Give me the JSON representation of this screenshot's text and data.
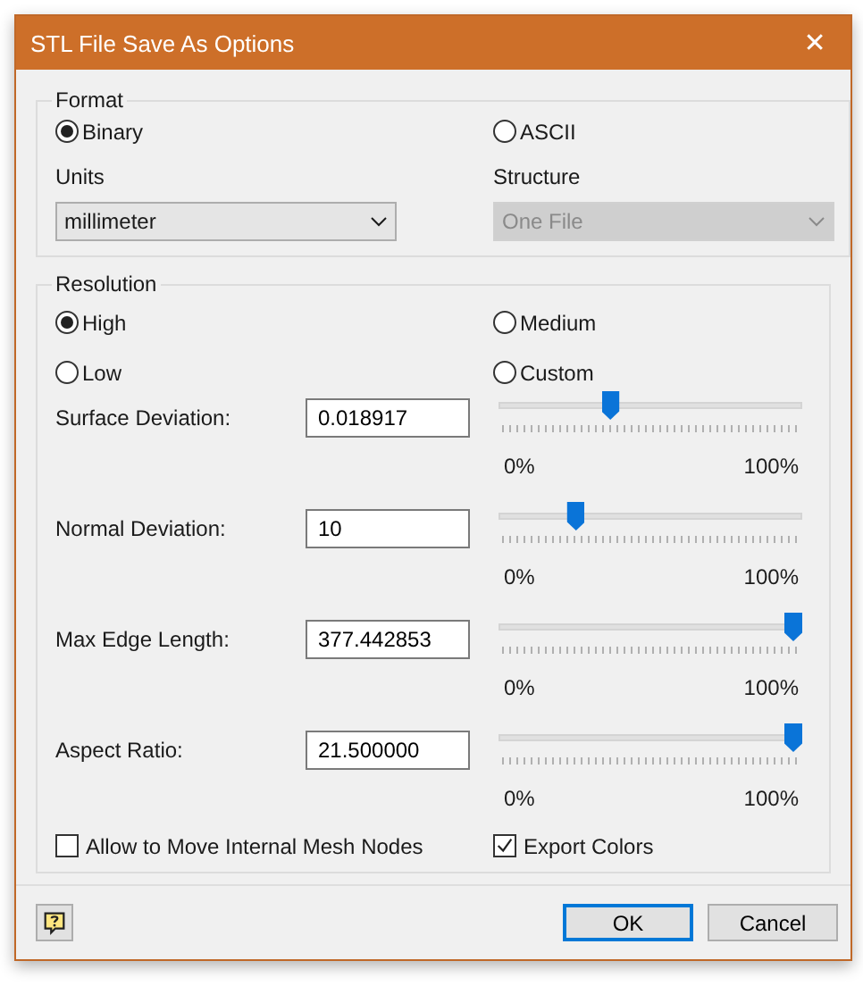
{
  "window": {
    "title": "STL File Save As Options",
    "close": "✕"
  },
  "format": {
    "title": "Format",
    "options": [
      {
        "label": "Binary",
        "selected": true
      },
      {
        "label": "ASCII",
        "selected": false
      }
    ],
    "units": {
      "label": "Units",
      "value": "millimeter",
      "disabled": false
    },
    "structure": {
      "label": "Structure",
      "value": "One File",
      "disabled": true
    }
  },
  "resolution": {
    "title": "Resolution",
    "options": [
      {
        "label": "High",
        "selected": true
      },
      {
        "label": "Medium",
        "selected": false
      },
      {
        "label": "Low",
        "selected": false
      },
      {
        "label": "Custom",
        "selected": false
      }
    ],
    "parameters": [
      {
        "label": "Surface Deviation:",
        "value": "0.018917",
        "level": 0.36,
        "min": "0%",
        "max": "100%"
      },
      {
        "label": "Normal Deviation:",
        "value": "10",
        "level": 0.24,
        "min": "0%",
        "max": "100%"
      },
      {
        "label": "Max Edge Length:",
        "value": "377.442853",
        "level": 1,
        "min": "0%",
        "max": "100%"
      },
      {
        "label": "Aspect Ratio:",
        "value": "21.500000",
        "level": 1,
        "min": "0%",
        "max": "100%"
      }
    ],
    "checkboxes": [
      {
        "label": "Allow to Move Internal Mesh Nodes",
        "checked": false
      },
      {
        "label": "Export Colors",
        "checked": true
      }
    ]
  },
  "buttons": [
    {
      "label": "OK",
      "default": true
    },
    {
      "label": "Cancel",
      "default": false
    }
  ]
}
